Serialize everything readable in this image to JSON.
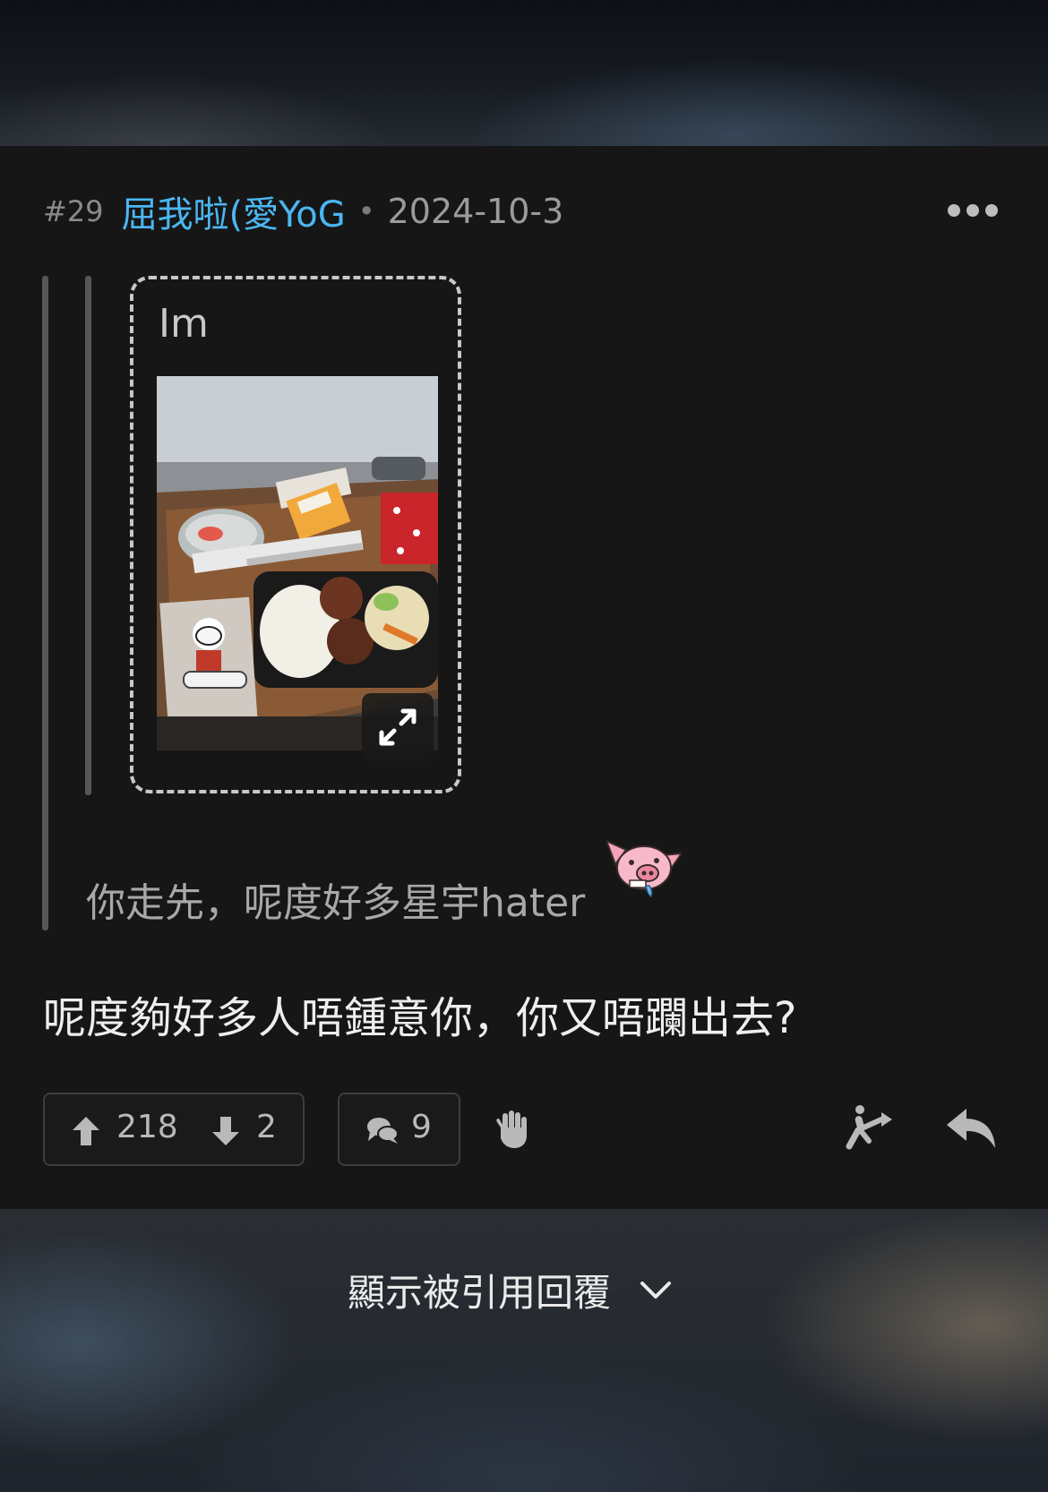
{
  "post": {
    "number": "#29",
    "username": "屈我啦(愛YoG",
    "separator": "•",
    "date": "2024-10-3"
  },
  "quote": {
    "image_card_title": "Im",
    "text": "你走先，呢度好多星宇hater"
  },
  "content": {
    "text": "呢度夠好多人唔鍾意你，你又唔躝出去?"
  },
  "actions": {
    "upvotes": "218",
    "downvotes": "2",
    "replies": "9"
  },
  "footer": {
    "show_quoted_label": "顯示被引用回覆"
  },
  "colors": {
    "username": "#4bb7f2",
    "card_background": "#161616",
    "icon": "#bdbdbd"
  },
  "icons": [
    "more-icon",
    "expand-icon",
    "pig-sticker",
    "upvote-arrow-icon",
    "downvote-arrow-icon",
    "comment-icon",
    "hand-icon",
    "share-icon",
    "reply-icon",
    "chevron-down-icon"
  ]
}
